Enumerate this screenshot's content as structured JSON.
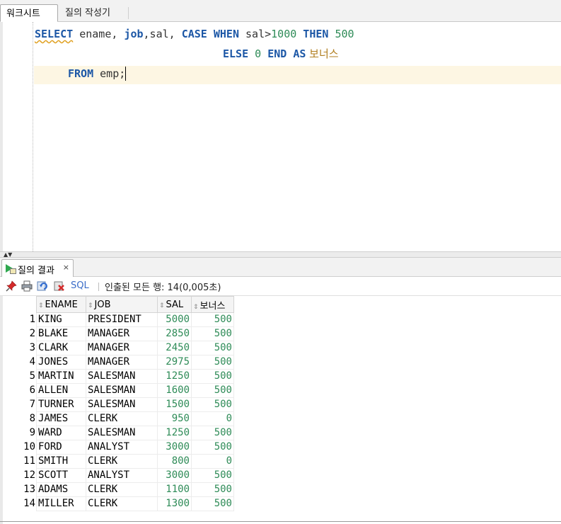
{
  "tabs": [
    {
      "label": "워크시트",
      "active": true
    },
    {
      "label": "질의 작성기",
      "active": false
    }
  ],
  "editor": {
    "line1": {
      "select": "SELECT",
      "ename": " ename, ",
      "job": "job",
      "sal": ",sal, ",
      "case": "CASE",
      "when": " WHEN",
      "cond": " sal>",
      "n1000": "1000",
      "then": " THEN",
      "n500": " 500"
    },
    "line2": {
      "else": "ELSE",
      "zero": " 0",
      "end": " END",
      "as": " AS",
      "alias": " 보너스"
    },
    "line3": {
      "from": "FROM",
      "table": " emp;"
    }
  },
  "results": {
    "tab_label": "질의 결과",
    "tab_close": "×",
    "sql_link": "SQL",
    "status": "인출된 모든 행: 14(0,005초)",
    "columns": [
      "ENAME",
      "JOB",
      "SAL",
      "보너스"
    ],
    "rows": [
      {
        "n": "1",
        "ename": "KING",
        "job": "PRESIDENT",
        "sal": "5000",
        "bonus": "500"
      },
      {
        "n": "2",
        "ename": "BLAKE",
        "job": "MANAGER",
        "sal": "2850",
        "bonus": "500"
      },
      {
        "n": "3",
        "ename": "CLARK",
        "job": "MANAGER",
        "sal": "2450",
        "bonus": "500"
      },
      {
        "n": "4",
        "ename": "JONES",
        "job": "MANAGER",
        "sal": "2975",
        "bonus": "500"
      },
      {
        "n": "5",
        "ename": "MARTIN",
        "job": "SALESMAN",
        "sal": "1250",
        "bonus": "500"
      },
      {
        "n": "6",
        "ename": "ALLEN",
        "job": "SALESMAN",
        "sal": "1600",
        "bonus": "500"
      },
      {
        "n": "7",
        "ename": "TURNER",
        "job": "SALESMAN",
        "sal": "1500",
        "bonus": "500"
      },
      {
        "n": "8",
        "ename": "JAMES",
        "job": "CLERK",
        "sal": "950",
        "bonus": "0"
      },
      {
        "n": "9",
        "ename": "WARD",
        "job": "SALESMAN",
        "sal": "1250",
        "bonus": "500"
      },
      {
        "n": "10",
        "ename": "FORD",
        "job": "ANALYST",
        "sal": "3000",
        "bonus": "500"
      },
      {
        "n": "11",
        "ename": "SMITH",
        "job": "CLERK",
        "sal": "800",
        "bonus": "0"
      },
      {
        "n": "12",
        "ename": "SCOTT",
        "job": "ANALYST",
        "sal": "3000",
        "bonus": "500"
      },
      {
        "n": "13",
        "ename": "ADAMS",
        "job": "CLERK",
        "sal": "1100",
        "bonus": "500"
      },
      {
        "n": "14",
        "ename": "MILLER",
        "job": "CLERK",
        "sal": "1300",
        "bonus": "500"
      }
    ]
  },
  "icons": [
    "pin-icon",
    "print-icon",
    "refresh-icon",
    "delete-icon",
    "play-icon",
    "grid-icon",
    "sort-icon"
  ],
  "colors": {
    "keyword": "#1c57a6",
    "number": "#2e8b57",
    "alias": "#b07d1e",
    "sql_link": "#3a6cc8"
  }
}
